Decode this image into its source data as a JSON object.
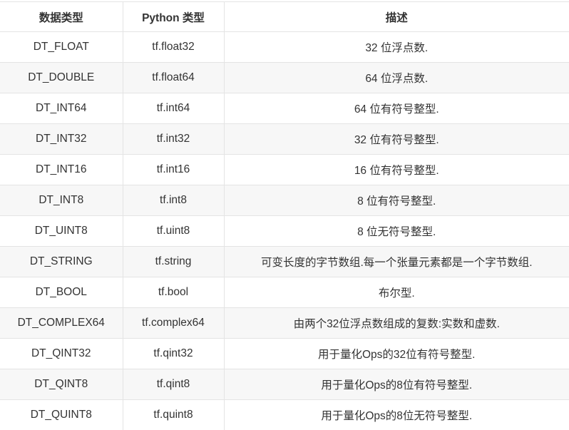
{
  "table": {
    "headers": [
      "数据类型",
      "Python 类型",
      "描述"
    ],
    "rows": [
      [
        "DT_FLOAT",
        "tf.float32",
        "32 位浮点数."
      ],
      [
        "DT_DOUBLE",
        "tf.float64",
        "64 位浮点数."
      ],
      [
        "DT_INT64",
        "tf.int64",
        "64 位有符号整型."
      ],
      [
        "DT_INT32",
        "tf.int32",
        "32 位有符号整型."
      ],
      [
        "DT_INT16",
        "tf.int16",
        "16 位有符号整型."
      ],
      [
        "DT_INT8",
        "tf.int8",
        "8 位有符号整型."
      ],
      [
        "DT_UINT8",
        "tf.uint8",
        "8 位无符号整型."
      ],
      [
        "DT_STRING",
        "tf.string",
        "可变长度的字节数组.每一个张量元素都是一个字节数组."
      ],
      [
        "DT_BOOL",
        "tf.bool",
        "布尔型."
      ],
      [
        "DT_COMPLEX64",
        "tf.complex64",
        "由两个32位浮点数组成的复数:实数和虚数."
      ],
      [
        "DT_QINT32",
        "tf.qint32",
        "用于量化Ops的32位有符号整型."
      ],
      [
        "DT_QINT8",
        "tf.qint8",
        "用于量化Ops的8位有符号整型."
      ],
      [
        "DT_QUINT8",
        "tf.quint8",
        "用于量化Ops的8位无符号整型."
      ]
    ]
  }
}
